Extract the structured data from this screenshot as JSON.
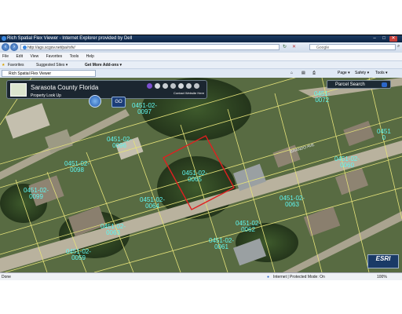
{
  "window": {
    "title": "Rich Spatial Flex Viewer - Internet Explorer provided by Dell",
    "minimize": "–",
    "maximize": "□",
    "close": "✕"
  },
  "address": {
    "url": "http://ags.scgov.net/pa/rsfv/",
    "search_placeholder": "Google"
  },
  "menu": [
    "File",
    "Edit",
    "View",
    "Favorites",
    "Tools",
    "Help"
  ],
  "favorites": {
    "favorites_label": "Favorites",
    "suggested_label": "Suggested Sites ▾",
    "addons_label": "Get More Add-ons ▾"
  },
  "tab": {
    "label": "Rich Spatial Flex Viewer",
    "page_label": "Page ▾",
    "safety_label": "Safety ▾",
    "tools_label": "Tools ▾"
  },
  "map_header": {
    "title": "Sarasota County Florida",
    "subtitle": "Property Look Up",
    "contact": "Contact Website Here",
    "go_label": "GO",
    "parcel_search": "Parcel Search"
  },
  "parcels": [
    {
      "line1": "0451-02-",
      "line2": "0096"
    },
    {
      "line1": "0451-02-",
      "line2": "0097"
    },
    {
      "line1": "0451-02-",
      "line2": "0098"
    },
    {
      "line1": "0451-02-",
      "line2": "0099"
    },
    {
      "line1": "0451-02-",
      "line2": "0065"
    },
    {
      "line1": "0451-02-",
      "line2": "0064"
    },
    {
      "line1": "0451-02-",
      "line2": "0063"
    },
    {
      "line1": "0451-02-",
      "line2": "0059"
    },
    {
      "line1": "0451-",
      "line2": "0072"
    },
    {
      "line1": "0451-02-",
      "line2": "0063"
    },
    {
      "line1": "0451-02-",
      "line2": "0062"
    },
    {
      "line1": "0451-02-",
      "line2": "0061"
    },
    {
      "line1": "0451",
      "line2": "0"
    },
    {
      "line1": "0451-02-",
      "line2": "0060"
    }
  ],
  "street": {
    "name": "BRANDO AVE"
  },
  "watermark": "ESRI",
  "status": {
    "left": "Done",
    "zone": "Internet | Protected Mode: On",
    "zoom": "100%"
  }
}
